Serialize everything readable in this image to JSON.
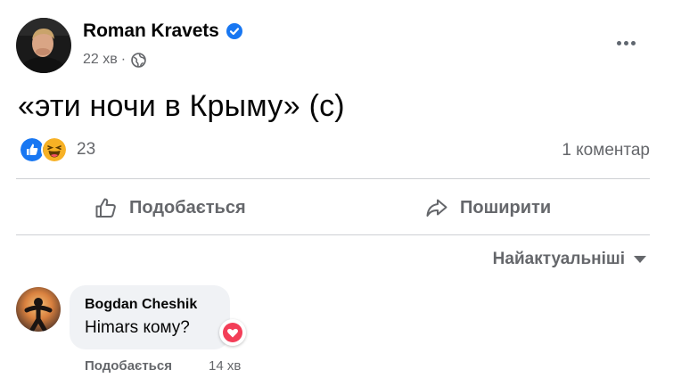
{
  "post": {
    "author": "Roman Kravets",
    "time": "22 хв",
    "separator": "·",
    "text": "«эти ночи в Крыму» (c)",
    "reactions": {
      "icons": [
        "like-icon",
        "haha-icon"
      ],
      "count": "23"
    },
    "comments_count": "1 коментар"
  },
  "actions": {
    "like_label": "Подобається",
    "share_label": "Поширити"
  },
  "sort": {
    "label": "Найактуальніші"
  },
  "comment": {
    "author": "Bogdan Cheshik",
    "text": "Himars кому?",
    "reaction_icon": "love-icon",
    "like_label": "Подобається",
    "time": "14 хв"
  },
  "colors": {
    "primary_text": "#050505",
    "secondary_text": "#65676b",
    "accent_blue": "#1877f2",
    "bubble_bg": "#f0f2f5",
    "divider": "#ced0d4",
    "love_red": "#f33e58"
  }
}
